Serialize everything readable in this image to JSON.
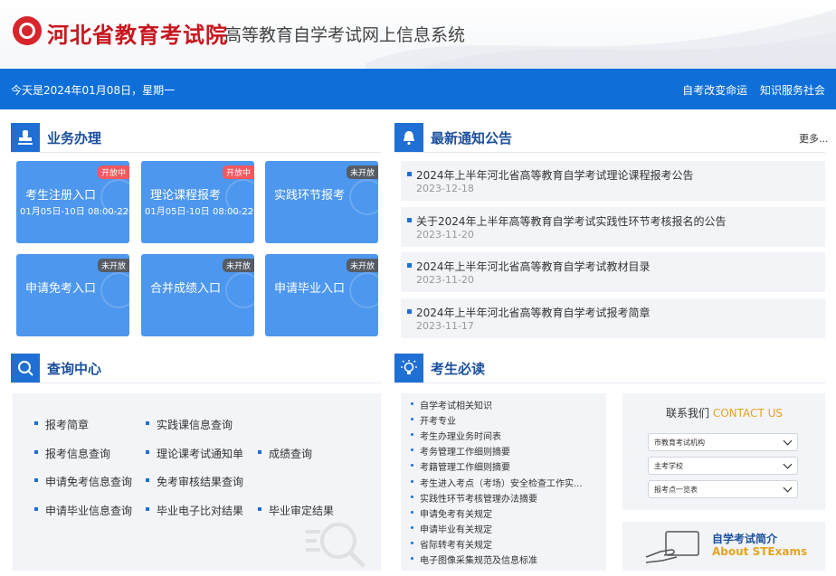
{
  "header": {
    "org_name": "河北省教育考试院",
    "system_name": "高等教育自学考试网上信息系统"
  },
  "topbar": {
    "today": "今天是2024年01月08日，星期一",
    "links": [
      "自考改变命运",
      "知识服务社会"
    ]
  },
  "business": {
    "title": "业务办理",
    "tiles": [
      {
        "name": "考生注册入口",
        "badge": "开放中",
        "date": "01月05日-10日 08:00-22:00"
      },
      {
        "name": "理论课程报考",
        "badge": "开放中",
        "date": "01月05日-10日 08:00-22:00"
      },
      {
        "name": "实践环节报考",
        "badge": "未开放",
        "date": ""
      },
      {
        "name": "申请免考入口",
        "badge": "未开放",
        "date": ""
      },
      {
        "name": "合并成绩入口",
        "badge": "未开放",
        "date": ""
      },
      {
        "name": "申请毕业入口",
        "badge": "未开放",
        "date": ""
      }
    ]
  },
  "notices": {
    "title": "最新通知公告",
    "more": "更多...",
    "items": [
      {
        "title": "2024年上半年河北省高等教育自学考试理论课程报考公告",
        "date": "2023-12-18"
      },
      {
        "title": "关于2024年上半年高等教育自学考试实践性环节考核报名的公告",
        "date": "2023-11-20"
      },
      {
        "title": "2024年上半年河北省高等教育自学考试教材目录",
        "date": "2023-11-20"
      },
      {
        "title": "2024年上半年河北省高等教育自学考试报考简章",
        "date": "2023-11-17"
      }
    ]
  },
  "query": {
    "title": "查询中心",
    "items": [
      "报考简章",
      "实践课信息查询",
      "报考信息查询",
      "理论课考试通知单",
      "成绩查询",
      "申请免考信息查询",
      "免考审核结果查询",
      "申请毕业信息查询",
      "毕业电子比对结果",
      "毕业审定结果"
    ]
  },
  "must_read": {
    "title": "考生必读",
    "items": [
      "自学考试相关知识",
      "开考专业",
      "考生办理业务时间表",
      "考务管理工作细则摘要",
      "考籍管理工作细则摘要",
      "考生进入考点（考场）安全检查工作实...",
      "实践性环节考核管理办法摘要",
      "申请免考有关规定",
      "申请毕业有关规定",
      "省际转考有关规定",
      "电子图像采集规范及信息标准"
    ]
  },
  "contact": {
    "title_cn": "联系我们",
    "title_en": "CONTACT US",
    "selects": [
      "市教育考试机构",
      "主考学校",
      "报考点一览表"
    ]
  },
  "intro": {
    "title_cn": "自学考试简介",
    "title_en": "About STExams"
  },
  "colors": {
    "brand_red": "#c8161e",
    "primary_blue": "#0f6fd8",
    "tile_blue": "#4d97ee",
    "accent_gold": "#e3a51f"
  }
}
